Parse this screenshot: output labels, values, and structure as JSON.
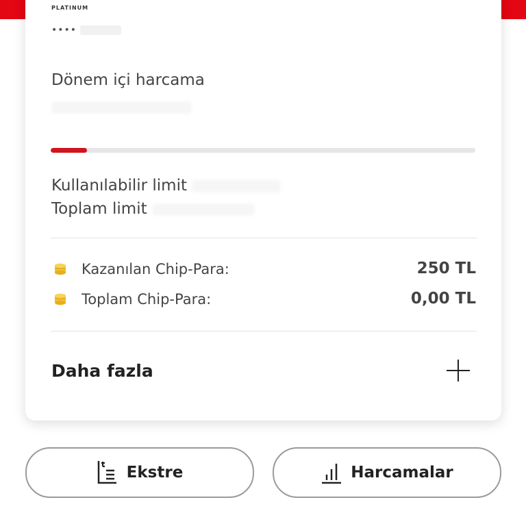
{
  "card": {
    "brand_sub": "PLATINUM",
    "masked_number": "••••",
    "period_spending_label": "Dönem içi harcama",
    "progress": 0.085,
    "available_limit_label": "Kullanılabilir limit",
    "total_limit_label": "Toplam limit",
    "chip": [
      {
        "label": "Kazanılan Chip-Para:",
        "value": "250 TL"
      },
      {
        "label": "Toplam Chip-Para:",
        "value": "0,00 TL"
      }
    ],
    "more_label": "Daha fazla"
  },
  "buttons": {
    "statement_label": "Ekstre",
    "spending_label": "Harcamalar"
  },
  "colors": {
    "accent_red": "#d0141e",
    "coin_yellow": "#f2c12e"
  },
  "icons": {
    "coin": "coin-stack-icon",
    "plus": "plus-icon",
    "statement": "statement-icon",
    "chart": "bar-chart-icon"
  }
}
